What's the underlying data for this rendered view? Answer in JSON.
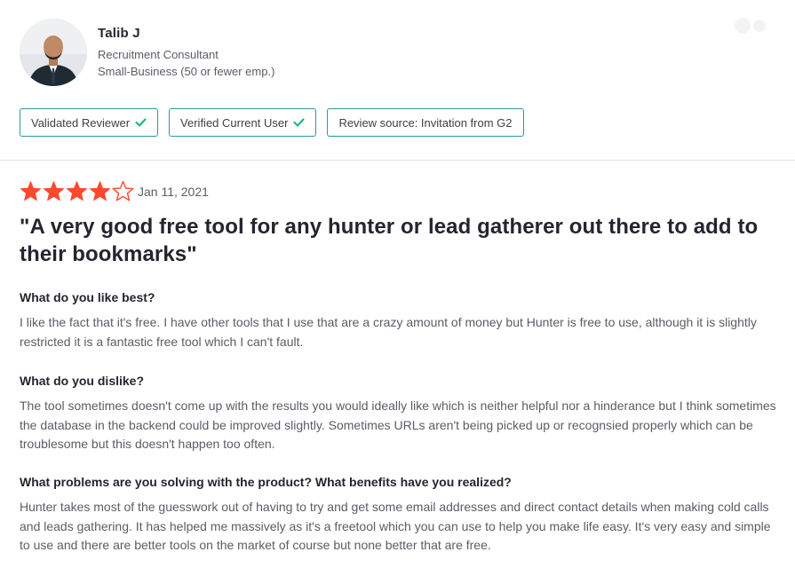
{
  "reviewer": {
    "name": "Talib J",
    "role": "Recruitment Consultant",
    "company_size": "Small-Business (50 or fewer emp.)"
  },
  "badges": [
    {
      "label": "Validated Reviewer",
      "has_check": true
    },
    {
      "label": "Verified Current User",
      "has_check": true
    },
    {
      "label": "Review source: Invitation from G2",
      "has_check": false
    }
  ],
  "review": {
    "rating": 4,
    "max_rating": 5,
    "date": "Jan 11, 2021",
    "title": "\"A very good free tool for any hunter or lead gatherer out there to add to their bookmarks\"",
    "sections": [
      {
        "question": "What do you like best?",
        "answer": "I like the fact that it's free. I have other tools that I use that are a crazy amount of money but Hunter is free to use, although it is slightly restricted it is a fantastic free tool which I can't fault."
      },
      {
        "question": "What do you dislike?",
        "answer": "The tool sometimes doesn't come up with the results you would ideally like which is neither helpful nor a hinderance but I think sometimes the database in the backend could be improved slightly. Sometimes URLs aren't being picked up or recognsied properly which can be troublesome but this doesn't happen too often."
      },
      {
        "question": "What problems are you solving with the product? What benefits have you realized?",
        "answer": "Hunter takes most of the guesswork out of having to try and get some email addresses and direct contact details when making cold calls and leads gathering. It has helped me massively as it's a freetool which you can use to help you make life easy. It's very easy and simple to use and there are better tools on the market of course but none better that are free."
      }
    ]
  },
  "colors": {
    "star": "#ff492c",
    "badge_border": "#2c9b95",
    "check": "#27b38d",
    "heading": "#252530",
    "body_text": "#5c5c66"
  },
  "icons": {
    "avatar": "reviewer-photo",
    "badge_check": "check-icon",
    "star": "star-icon"
  }
}
